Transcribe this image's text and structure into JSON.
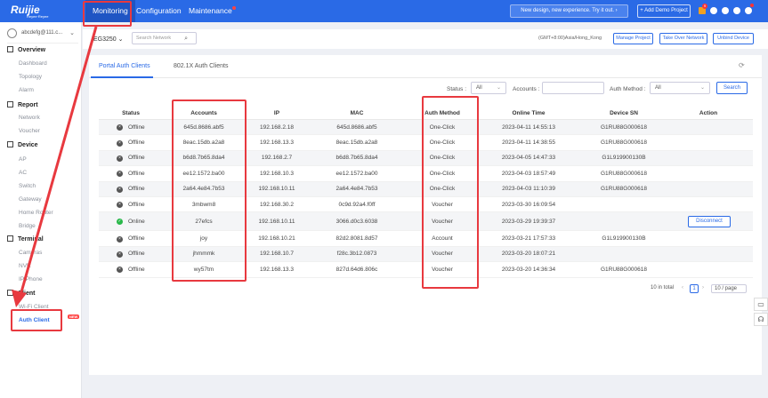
{
  "topbar": {
    "logo": "Ruijie",
    "logo_sub": "Reyee·Reyee",
    "nav": [
      "Monitoring",
      "Configuration",
      "Maintenance"
    ],
    "banner": "New design, new experience. Try it out.  ›",
    "demo_button": "+ Add Demo Project",
    "notif_count": "9"
  },
  "sidebar": {
    "user": "abcdefg@111.c...",
    "sections": [
      {
        "title": "Overview",
        "items": [
          "Dashboard",
          "Topology",
          "Alarm"
        ]
      },
      {
        "title": "Report",
        "items": [
          "Network",
          "Voucher"
        ]
      },
      {
        "title": "Device",
        "items": [
          "AP",
          "AC",
          "Switch",
          "Gateway",
          "Home Router",
          "Bridge"
        ]
      },
      {
        "title": "Terminal",
        "items": [
          "Cameras",
          "NVR",
          "IP Phone"
        ]
      },
      {
        "title": "Client",
        "items": [
          "Wi-Fi Client",
          "Auth Client"
        ]
      }
    ],
    "active_item": "Auth Client",
    "new_tag": "NEW"
  },
  "toolbar": {
    "group": "EG3250",
    "search_placeholder": "Search Network",
    "timezone": "(GMT+8:00)Asia/Hong_Kong",
    "buttons": [
      "Manage Project",
      "Take Over Network",
      "Unbind Device"
    ]
  },
  "tabs": [
    "Portal Auth Clients",
    "802.1X Auth Clients"
  ],
  "filters": {
    "status_label": "Status :",
    "status_value": "All",
    "accounts_label": "Accounts :",
    "accounts_value": "",
    "auth_label": "Auth Method :",
    "auth_value": "All",
    "search_btn": "Search"
  },
  "table": {
    "columns": [
      "Status",
      "Accounts",
      "IP",
      "MAC",
      "Auth Method",
      "Online Time",
      "Device SN",
      "Action"
    ],
    "rows": [
      {
        "status": "Offline",
        "account": "645d.8686.abf5",
        "ip": "192.168.2.18",
        "mac": "645d.8686.abf5",
        "auth": "One-Click",
        "time": "2023-04-11 14:55:13",
        "sn": "G1RU88G000618",
        "action": ""
      },
      {
        "status": "Offline",
        "account": "8eac.15db.a2a8",
        "ip": "192.168.13.3",
        "mac": "8eac.15db.a2a8",
        "auth": "One-Click",
        "time": "2023-04-11 14:38:55",
        "sn": "G1RU88G000618",
        "action": ""
      },
      {
        "status": "Offline",
        "account": "b6d8.7b65.8da4",
        "ip": "192.168.2.7",
        "mac": "b6d8.7b65.8da4",
        "auth": "One-Click",
        "time": "2023-04-05 14:47:33",
        "sn": "G1L919900130B",
        "action": ""
      },
      {
        "status": "Offline",
        "account": "ee12.1572.ba00",
        "ip": "192.168.10.3",
        "mac": "ee12.1572.ba00",
        "auth": "One-Click",
        "time": "2023-04-03 18:57:49",
        "sn": "G1RU88G000618",
        "action": ""
      },
      {
        "status": "Offline",
        "account": "2a64.4e84.7b53",
        "ip": "192.168.10.11",
        "mac": "2a64.4e84.7b53",
        "auth": "One-Click",
        "time": "2023-04-03 11:10:39",
        "sn": "G1RU88G000618",
        "action": ""
      },
      {
        "status": "Offline",
        "account": "3mbwm8",
        "ip": "192.168.30.2",
        "mac": "0c9d.92a4.f0ff",
        "auth": "Voucher",
        "time": "2023-03-30 16:09:54",
        "sn": "",
        "action": ""
      },
      {
        "status": "Online",
        "account": "27efcs",
        "ip": "192.168.10.11",
        "mac": "3066.d0c3.6038",
        "auth": "Voucher",
        "time": "2023-03-29 19:39:37",
        "sn": "",
        "action": "Disconnect"
      },
      {
        "status": "Offline",
        "account": "joy",
        "ip": "192.168.10.21",
        "mac": "82d2.8081.8d57",
        "auth": "Account",
        "time": "2023-03-21 17:57:33",
        "sn": "G1L919900130B",
        "action": ""
      },
      {
        "status": "Offline",
        "account": "jhmmmk",
        "ip": "192.168.10.7",
        "mac": "f28c.3b12.0873",
        "auth": "Voucher",
        "time": "2023-03-20 18:07:21",
        "sn": "",
        "action": ""
      },
      {
        "status": "Offline",
        "account": "wy57tm",
        "ip": "192.168.13.3",
        "mac": "827d.64d6.806c",
        "auth": "Voucher",
        "time": "2023-03-20 14:36:34",
        "sn": "G1RU88G000618",
        "action": ""
      }
    ]
  },
  "pagination": {
    "total": "10 in total",
    "page": "1",
    "page_size": "10 / page"
  },
  "colors": {
    "brand": "#2a6ae6",
    "highlight": "#e8393f",
    "online": "#29b84a"
  }
}
